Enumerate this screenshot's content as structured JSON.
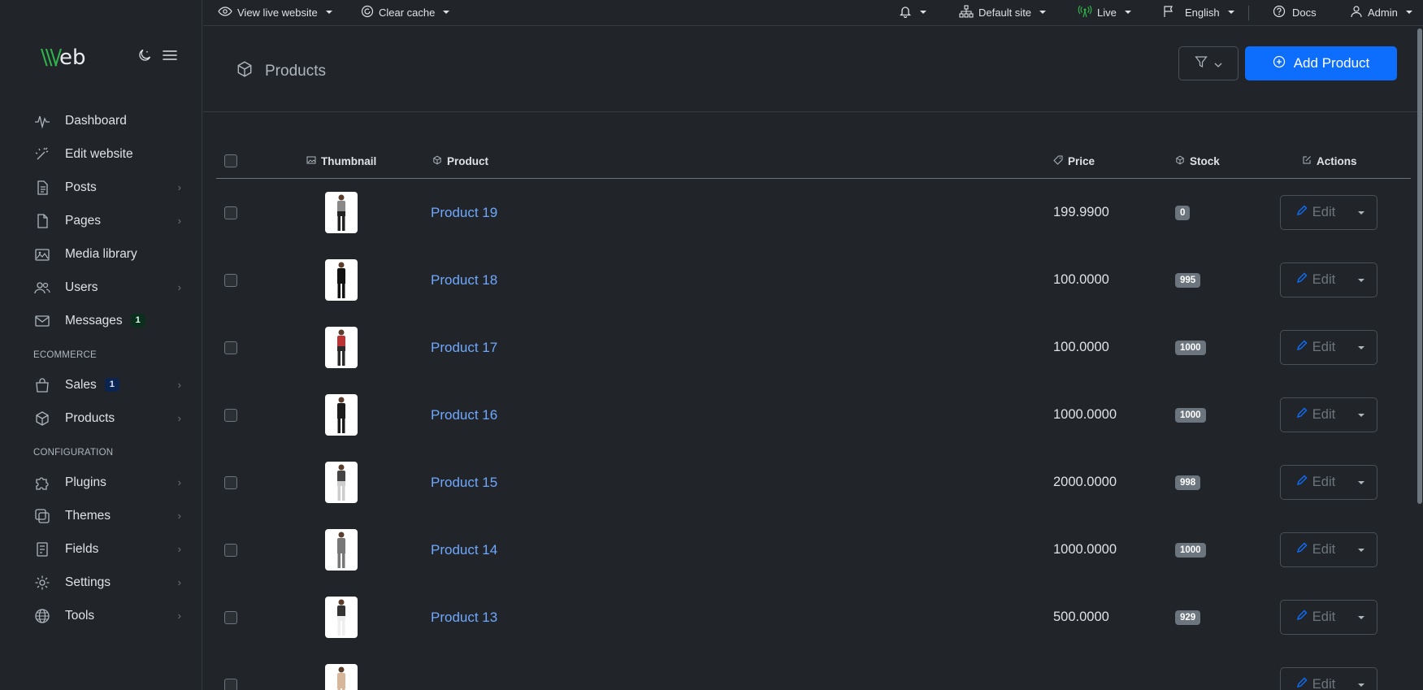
{
  "brand": {
    "logo_w": "\\\\\\/",
    "logo_rest": "eb"
  },
  "sidebar": {
    "items": [
      {
        "label": "Dashboard",
        "icon": "pulse-icon",
        "chevron": false
      },
      {
        "label": "Edit website",
        "icon": "magic-wand-icon",
        "chevron": false
      },
      {
        "label": "Posts",
        "icon": "document-icon",
        "chevron": true
      },
      {
        "label": "Pages",
        "icon": "page-icon",
        "chevron": true
      },
      {
        "label": "Media library",
        "icon": "images-icon",
        "chevron": false
      },
      {
        "label": "Users",
        "icon": "users-icon",
        "chevron": true
      },
      {
        "label": "Messages",
        "icon": "envelope-icon",
        "chevron": false,
        "badge": "1"
      }
    ],
    "heading_ecommerce": "ECOMMERCE",
    "ecommerce_items": [
      {
        "label": "Sales",
        "icon": "shopping-bag-icon",
        "chevron": true,
        "badge": "1"
      },
      {
        "label": "Products",
        "icon": "box-icon",
        "chevron": true
      }
    ],
    "heading_configuration": "CONFIGURATION",
    "config_items": [
      {
        "label": "Plugins",
        "icon": "puzzle-icon",
        "chevron": true
      },
      {
        "label": "Themes",
        "icon": "layers-icon",
        "chevron": true
      },
      {
        "label": "Fields",
        "icon": "fields-icon",
        "chevron": true
      },
      {
        "label": "Settings",
        "icon": "gear-icon",
        "chevron": true
      },
      {
        "label": "Tools",
        "icon": "globe-icon",
        "chevron": true
      }
    ]
  },
  "topbar": {
    "view_live": "View live website",
    "clear_cache": "Clear cache",
    "site": "Default site",
    "state": "Live",
    "language": "English",
    "docs": "Docs",
    "user": "Admin"
  },
  "header": {
    "title": "Products",
    "add_button": "Add Product"
  },
  "table": {
    "columns": {
      "thumbnail": "Thumbnail",
      "product": "Product",
      "price": "Price",
      "stock": "Stock",
      "actions": "Actions"
    },
    "edit_label": "Edit",
    "rows": [
      {
        "name": "Product 19",
        "price": "199.9900",
        "stock": "0",
        "dress": "#222",
        "top": "#888"
      },
      {
        "name": "Product 18",
        "price": "100.0000",
        "stock": "995",
        "dress": "#111",
        "top": "#111"
      },
      {
        "name": "Product 17",
        "price": "100.0000",
        "stock": "1000",
        "dress": "#2a2a2a",
        "top": "#b33"
      },
      {
        "name": "Product 16",
        "price": "1000.0000",
        "stock": "1000",
        "dress": "#1b1b1b",
        "top": "#1b1b1b"
      },
      {
        "name": "Product 15",
        "price": "2000.0000",
        "stock": "998",
        "dress": "#ccc",
        "top": "#444"
      },
      {
        "name": "Product 14",
        "price": "1000.0000",
        "stock": "1000",
        "dress": "#777",
        "top": "#777"
      },
      {
        "name": "Product 13",
        "price": "500.0000",
        "stock": "929",
        "dress": "#eee",
        "top": "#333"
      },
      {
        "name": "",
        "price": "",
        "stock": "",
        "dress": "#d7b69a",
        "top": "#d7b69a"
      }
    ]
  },
  "colors": {
    "accent": "#0d6efd",
    "link": "#6ea8fe",
    "brand_green": "#2fb34a"
  }
}
